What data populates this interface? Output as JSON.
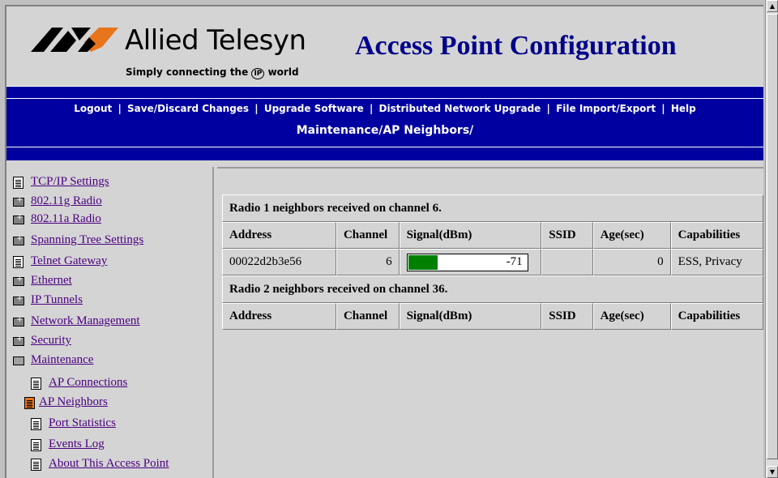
{
  "header": {
    "brand": "Allied Telesyn",
    "tagline_pre": "Simply connecting the",
    "tagline_ip": "IP",
    "tagline_post": "world",
    "title": "Access Point Configuration"
  },
  "nav": {
    "links": [
      "Logout",
      "Save/Discard Changes",
      "Upgrade Software",
      "Distributed Network Upgrade",
      "File Import/Export",
      "Help"
    ],
    "separator": "|",
    "breadcrumb": "Maintenance/AP Neighbors/"
  },
  "sidebar": {
    "items": [
      {
        "label": "TCP/IP Settings",
        "icon": "document-icon"
      },
      {
        "label": "802.11g Radio",
        "icon": "folder-icon"
      },
      {
        "label": "802.11a Radio",
        "icon": "folder-icon"
      },
      {
        "label": "Spanning Tree Settings",
        "icon": "folder-icon"
      },
      {
        "label": "Telnet Gateway",
        "icon": "document-icon"
      },
      {
        "label": "Ethernet",
        "icon": "folder-icon"
      },
      {
        "label": "IP Tunnels",
        "icon": "folder-icon"
      },
      {
        "label": "Network Management",
        "icon": "folder-icon"
      },
      {
        "label": "Security",
        "icon": "folder-icon"
      },
      {
        "label": "Maintenance",
        "icon": "open-folder-icon"
      },
      {
        "label": "AP Connections",
        "icon": "document-icon"
      },
      {
        "label": "AP Neighbors",
        "icon": "selected-document-icon"
      },
      {
        "label": "Port Statistics",
        "icon": "document-icon"
      },
      {
        "label": "Events Log",
        "icon": "document-icon"
      },
      {
        "label": "About This Access Point",
        "icon": "document-icon"
      }
    ]
  },
  "radio1": {
    "caption": "Radio 1 neighbors received on channel 6.",
    "columns": [
      "Address",
      "Channel",
      "Signal(dBm)",
      "SSID",
      "Age(sec)",
      "Capabilities"
    ],
    "rows": [
      {
        "address": "00022d2b3e56",
        "channel": "6",
        "signal": "-71",
        "signal_fraction": 0.25,
        "ssid": "",
        "age": "0",
        "capabilities": "ESS, Privacy"
      }
    ]
  },
  "radio2": {
    "caption": "Radio 2 neighbors received on channel 36.",
    "columns": [
      "Address",
      "Channel",
      "Signal(dBm)",
      "SSID",
      "Age(sec)",
      "Capabilities"
    ]
  },
  "colors": {
    "nav_band": "#0000a0",
    "title": "#00008b",
    "signal_fill": "#008000",
    "selected_icon": "#e8741c"
  }
}
